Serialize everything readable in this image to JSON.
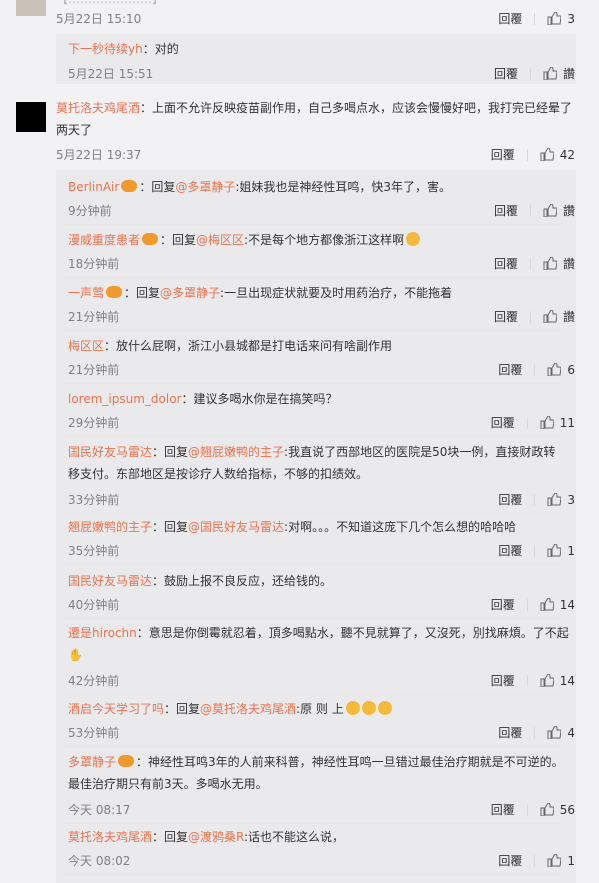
{
  "top": {
    "partial_text": "【…………………】",
    "time": "5月22日 15:10",
    "reply": "回覆",
    "likes": "3"
  },
  "sub0": {
    "name": "下一秒待续yh",
    "text": "：对的",
    "time": "5月22日 15:51",
    "reply": "回覆",
    "like": "讚"
  },
  "main": {
    "name": "莫托洛夫鸡尾酒",
    "text1": "：上面不允许反映疫苗副作用，自己多喝点水，应该会慢慢好吧，我打完已经晕了",
    "text2": "两天了",
    "time": "5月22日 19:37",
    "reply": "回覆",
    "likes": "42"
  },
  "replies": [
    {
      "name": "BerlinAir",
      "text": "：回复",
      "at": "@多罩静子",
      "rest": ":姐妹我也是神经性耳鸣，快3年了，害。",
      "time": "9分钟前",
      "reply": "回覆",
      "like": "讚"
    },
    {
      "name": "漫威重度患者",
      "text": "：回复",
      "at": "@梅区区",
      "rest": ":不是每个地方都像浙江这样啊",
      "time": "18分钟前",
      "reply": "回覆",
      "like": "讚"
    },
    {
      "name": "一声莺",
      "text": "：回复",
      "at": "@多罩静子",
      "rest": ":一旦出现症状就要及时用药治疗，不能拖着",
      "time": "21分钟前",
      "reply": "回覆",
      "like": "讚"
    },
    {
      "name": "梅区区",
      "text": "：放什么屁啊，浙江小县城都是打电话来问有啥副作用",
      "time": "21分钟前",
      "reply": "回覆",
      "like": "6"
    },
    {
      "name": "lorem_ipsum_dolor",
      "text": "：建议多喝水你是在搞笑吗？",
      "time": "29分钟前",
      "reply": "回覆",
      "like": "11"
    },
    {
      "name": "国民好友马雷达",
      "text": "：回复",
      "at": "@翘屁嫩鸭的主子",
      "rest": ":我直说了西部地区的医院是50块一例，直接财政转",
      "line2": "移支付。东部地区是按诊疗人数给指标，不够的扣绩效。",
      "time": "33分钟前",
      "reply": "回覆",
      "like": "3"
    },
    {
      "name": "翘屁嫩鸭的主子",
      "text": "：回复",
      "at": "@国民好友马雷达",
      "rest": ":对啊。。。不知道这庞下几个怎么想的哈哈哈",
      "time": "35分钟前",
      "reply": "回覆",
      "like": "1"
    },
    {
      "name": "国民好友马雷达",
      "text": "：鼓励上报不良反应，还给钱的。",
      "time": "40分钟前",
      "reply": "回覆",
      "like": "14"
    },
    {
      "name": "遷是hirochn",
      "text": "：意思是你倒霉就忍着，頂多喝點水，聽不見就算了，又沒死，別找麻煩。了不起",
      "line2": "",
      "time": "42分钟前",
      "reply": "回覆",
      "like": "14"
    },
    {
      "name": "酒启今天学习了吗",
      "text": "：回复",
      "at": "@莫托洛夫鸡尾酒",
      "rest": ":原 则 上",
      "time": "53分钟前",
      "reply": "回覆",
      "like": "4"
    },
    {
      "name": "多罩静子",
      "text": "：神经性耳鸣3年的人前来科普，神经性耳鸣一旦错过最佳治疗期就是不可逆的。",
      "line2": "最佳治疗期只有前3天。多喝水无用。",
      "time": "今天 08:17",
      "reply": "回覆",
      "like": "56"
    },
    {
      "name": "莫托洛夫鸡尾酒",
      "text": "：回复",
      "at": "@渡鸦桑R",
      "rest": ":话也不能这么说，",
      "time": "今天 08:02",
      "reply": "回覆",
      "like": "1"
    }
  ],
  "colors": {
    "accent": "#eb7350",
    "text": "#333333",
    "muted": "#808080",
    "bg": "#f2f2f5",
    "panel": "#eaeaec"
  }
}
